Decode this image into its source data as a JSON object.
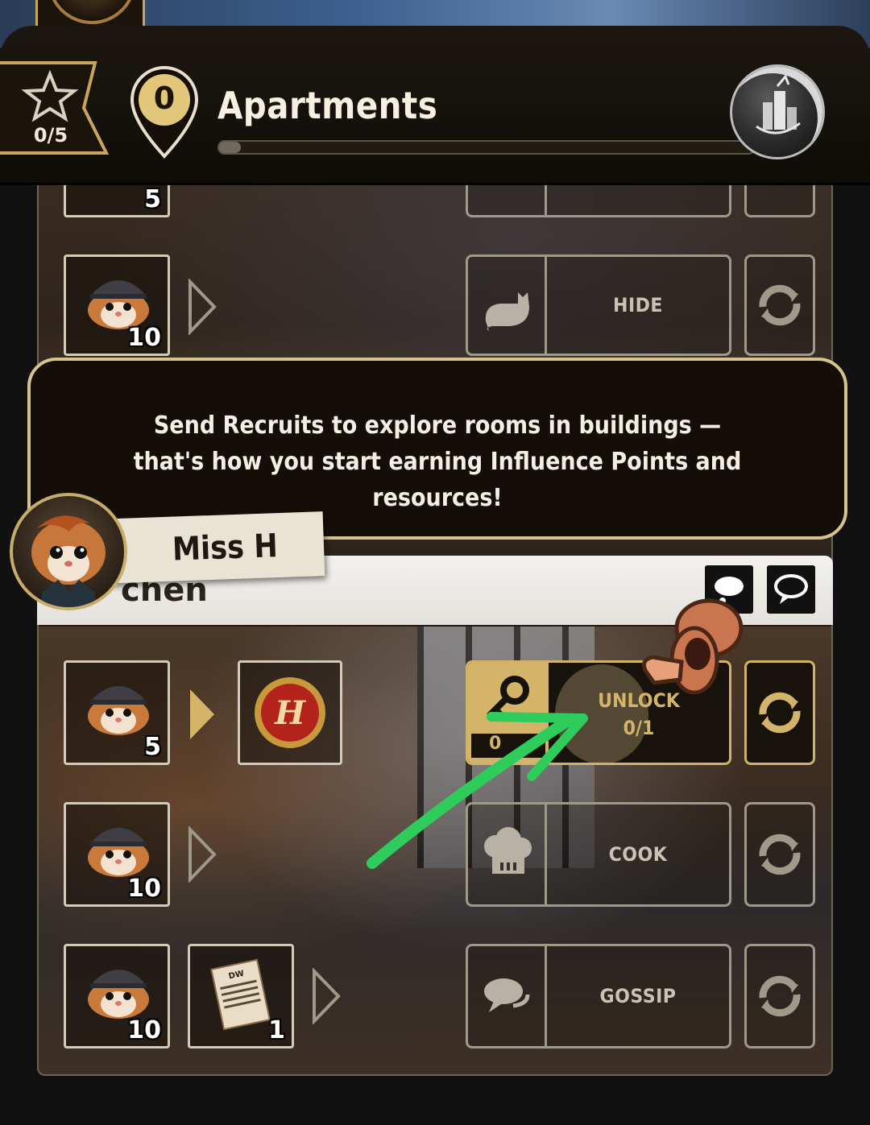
{
  "header": {
    "stars": "0/5",
    "location_count": "0",
    "title": "Apartments",
    "progress": 0.02
  },
  "room_top": {
    "rows": [
      {
        "recruit_count": "5"
      },
      {
        "recruit_count": "10",
        "action": "HIDE"
      }
    ]
  },
  "dialog": {
    "text": "Send Recruits to explore rooms in buildings — that's how you start earning Influence Points and resources!",
    "speaker": "Miss H"
  },
  "kitchen": {
    "title_visible": "chen",
    "rows": [
      {
        "recruit_count": "5",
        "unlock_label": "UNLOCK",
        "unlock_progress": "0/1",
        "key_count": "0"
      },
      {
        "recruit_count": "10",
        "action": "COOK"
      },
      {
        "recruit_count": "10",
        "item_count": "1",
        "item_tag": "DW",
        "action": "GOSSIP"
      }
    ]
  },
  "colors": {
    "gold": "#d3b468",
    "panel_border": "#9f998a",
    "dialog_border": "#d7c48c",
    "tutorial_arrow": "#2ecc5a"
  },
  "icons": [
    "star-icon",
    "location-pin-icon",
    "city-icon",
    "hamster-recruit-icon",
    "cat-icon",
    "refresh-icon",
    "key-icon",
    "h-coin-icon",
    "chef-hat-icon",
    "speech-bubble-icon",
    "newspaper-icon",
    "pointing-hand-icon"
  ]
}
